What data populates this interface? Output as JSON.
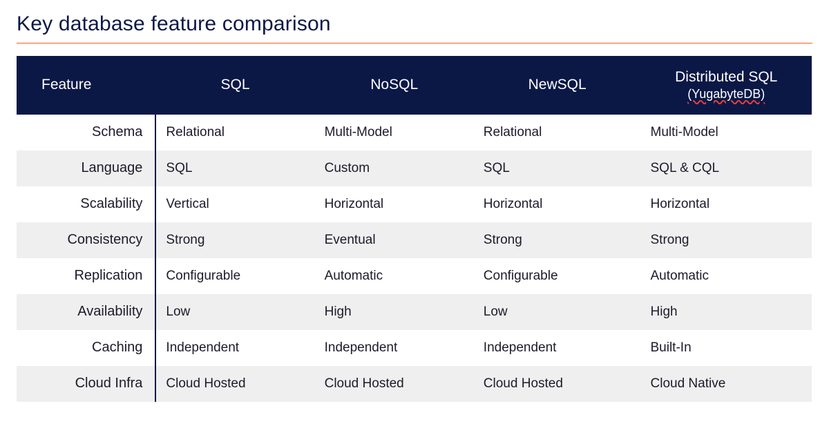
{
  "title": "Key database feature comparison",
  "colors": {
    "heading": "#0b1846",
    "rule": "#ff5a1f",
    "header_bg": "#0b1846"
  },
  "header": {
    "feature": "Feature",
    "sql": "SQL",
    "nosql": "NoSQL",
    "newsql": "NewSQL",
    "dsql_line1": "Distributed SQL",
    "dsql_line2": "(YugabyteDB)"
  },
  "rows": [
    {
      "feature": "Schema",
      "sql": "Relational",
      "nosql": "Multi-Model",
      "newsql": "Relational",
      "dsql": "Multi-Model"
    },
    {
      "feature": "Language",
      "sql": "SQL",
      "nosql": "Custom",
      "newsql": "SQL",
      "dsql": "SQL & CQL"
    },
    {
      "feature": "Scalability",
      "sql": "Vertical",
      "nosql": "Horizontal",
      "newsql": "Horizontal",
      "dsql": "Horizontal"
    },
    {
      "feature": "Consistency",
      "sql": "Strong",
      "nosql": "Eventual",
      "newsql": "Strong",
      "dsql": "Strong"
    },
    {
      "feature": "Replication",
      "sql": "Configurable",
      "nosql": "Automatic",
      "newsql": "Configurable",
      "dsql": "Automatic"
    },
    {
      "feature": "Availability",
      "sql": "Low",
      "nosql": "High",
      "newsql": "Low",
      "dsql": "High"
    },
    {
      "feature": "Caching",
      "sql": "Independent",
      "nosql": "Independent",
      "newsql": "Independent",
      "dsql": "Built-In"
    },
    {
      "feature": "Cloud Infra",
      "sql": "Cloud Hosted",
      "nosql": "Cloud Hosted",
      "newsql": "Cloud Hosted",
      "dsql": "Cloud Native"
    }
  ],
  "chart_data": {
    "type": "table",
    "title": "Key database feature comparison",
    "columns": [
      "Feature",
      "SQL",
      "NoSQL",
      "NewSQL",
      "Distributed SQL (YugabyteDB)"
    ],
    "rows": [
      [
        "Schema",
        "Relational",
        "Multi-Model",
        "Relational",
        "Multi-Model"
      ],
      [
        "Language",
        "SQL",
        "Custom",
        "SQL",
        "SQL & CQL"
      ],
      [
        "Scalability",
        "Vertical",
        "Horizontal",
        "Horizontal",
        "Horizontal"
      ],
      [
        "Consistency",
        "Strong",
        "Eventual",
        "Strong",
        "Strong"
      ],
      [
        "Replication",
        "Configurable",
        "Automatic",
        "Configurable",
        "Automatic"
      ],
      [
        "Availability",
        "Low",
        "High",
        "Low",
        "High"
      ],
      [
        "Caching",
        "Independent",
        "Independent",
        "Independent",
        "Built-In"
      ],
      [
        "Cloud Infra",
        "Cloud Hosted",
        "Cloud Hosted",
        "Cloud Hosted",
        "Cloud Native"
      ]
    ]
  }
}
